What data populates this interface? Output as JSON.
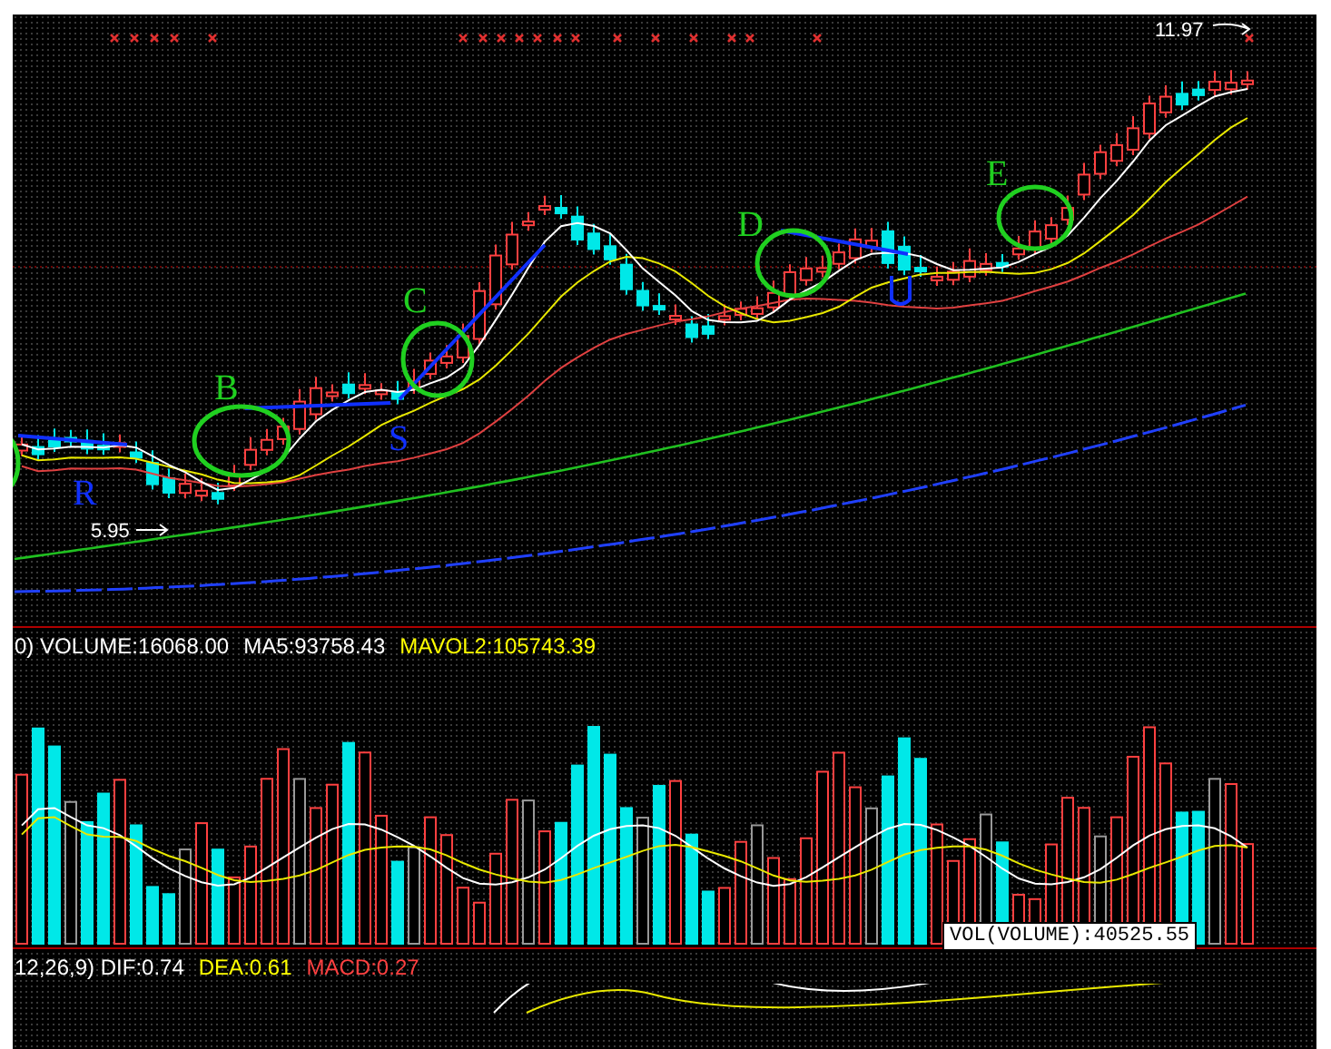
{
  "price_panel": {
    "high_label": "11.97",
    "low_label": "5.95",
    "circle_labels": [
      {
        "text": "B"
      },
      {
        "text": "C"
      },
      {
        "text": "D"
      },
      {
        "text": "E"
      }
    ],
    "trend_labels": [
      {
        "text": "R"
      },
      {
        "text": "S"
      }
    ]
  },
  "volume_panel": {
    "legend": [
      {
        "text": "0) VOLUME:16068.00",
        "color": "#ffffff"
      },
      {
        "text": "MA5:93758.43",
        "color": "#ffffff"
      },
      {
        "text": "MAVOL2:105743.39",
        "color": "#ffff00"
      }
    ],
    "tooltip": "VOL(VOLUME):40525.55"
  },
  "macd_panel": {
    "legend": [
      {
        "text": "12,26,9) DIF:0.74",
        "color": "#ffffff"
      },
      {
        "text": "DEA:0.61",
        "color": "#ffff00"
      },
      {
        "text": "MACD:0.27",
        "color": "#ff4040"
      }
    ]
  }
}
